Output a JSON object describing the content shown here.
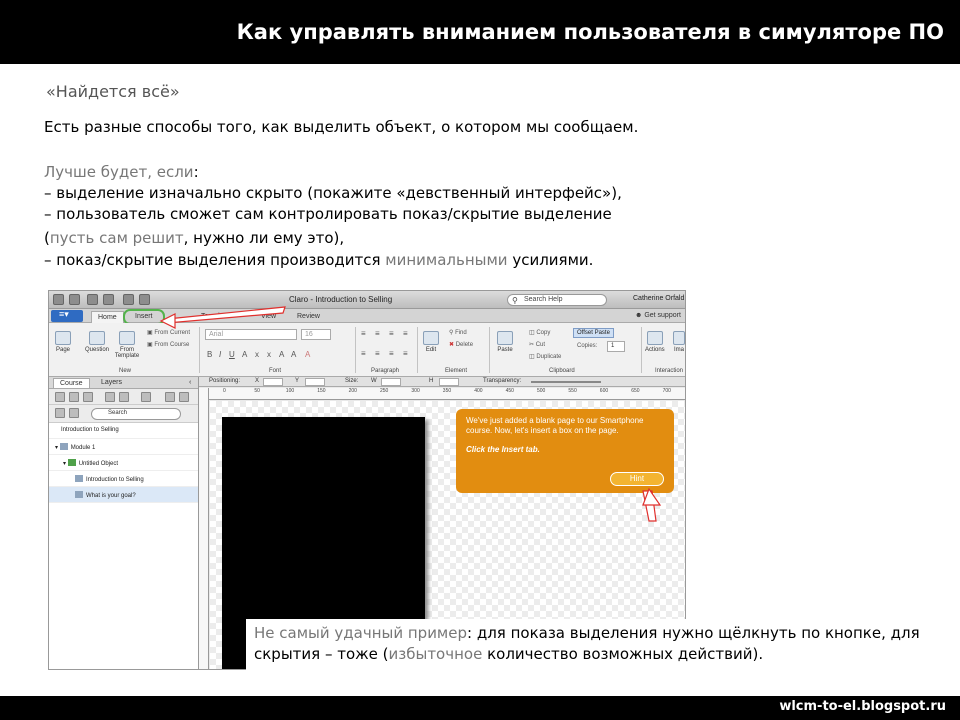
{
  "slide": {
    "title": "Как управлять вниманием пользователя в симуляторе ПО",
    "subtitle": "«Найдется всё»",
    "intro": "Есть разные способы того, как выделить объект, о котором мы сообщаем.",
    "better_label": "Лучше будет, если",
    "colon": ":",
    "line1": "– выделение изначально скрыто (покажите «девственный интерфейс»),",
    "line2": "– пользователь сможет сам контролировать показ/скрытие выделение",
    "line3_open": "(",
    "line3_gray": "пусть сам решит",
    "line3_rest": ", нужно ли ему это),",
    "line4_start": "– показ/скрытие выделения производится ",
    "line4_gray": "минимальными",
    "line4_end": " усилиями.",
    "caption_gray1": "Не самый удачный пример",
    "caption_part1": ": для показа выделения нужно щёлкнуть по кнопке, для скрытия – тоже (",
    "caption_gray2": "избыточное",
    "caption_part2": " количество возможных действий).",
    "footer": "wlcm-to-el.blogspot.ru"
  },
  "app": {
    "window_title": "Claro - Introduction to Selling",
    "help_search": "Search Help",
    "user_name": "Catherine Orfald",
    "get_support": "Get support",
    "tabs": [
      "Home",
      "Insert",
      "Template",
      "View",
      "Review"
    ],
    "ribbon": {
      "page": "Page",
      "question": "Question",
      "from_template": "From Template",
      "from_current": "From Current",
      "from_course": "From Course",
      "group_new": "New",
      "font_name": "Arial",
      "font_size": "16",
      "group_font": "Font",
      "group_paragraph": "Paragraph",
      "edit": "Edit",
      "find": "Find",
      "delete": "Delete",
      "group_element": "Element",
      "paste": "Paste",
      "copy": "Copy",
      "cut": "Cut",
      "duplicate": "Duplicate",
      "offset_paste": "Offset Paste",
      "copies": "Copies:",
      "copies_value": "1",
      "group_clipboard": "Clipboard",
      "actions": "Actions",
      "image": "Ima",
      "group_interactions": "Interaction"
    },
    "left_panel": {
      "tab_course": "Course",
      "tab_layers": "Layers",
      "search": "Search",
      "tree": [
        "Introduction to Selling",
        "Module 1",
        "Untitled Object",
        "Introduction to Selling",
        "What is your goal?"
      ]
    },
    "positioning_bar": {
      "positioning": "Positioning:",
      "x": "X",
      "y": "Y",
      "size": "Size:",
      "w": "W",
      "h": "H",
      "transparency": "Transparency:"
    },
    "ruler": [
      "0",
      "50",
      "100",
      "150",
      "200",
      "250",
      "300",
      "350",
      "400",
      "450",
      "500",
      "550",
      "600",
      "650",
      "700"
    ],
    "callout": {
      "text": "We've just added a blank page to our Smartphone course. Now, let's insert a box on the page.",
      "instruction": "Click the Insert tab.",
      "hint": "Hint"
    }
  },
  "colors": {
    "callout": "#e28d10",
    "highlight_ring": "#54b34c",
    "arrow": "#e0302d"
  }
}
